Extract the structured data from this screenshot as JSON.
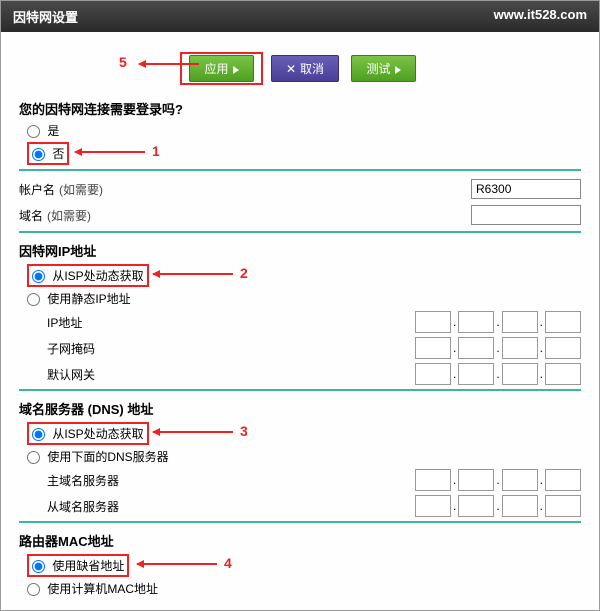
{
  "title_bar": "因特网设置",
  "watermark": "www.it528.com",
  "buttons": {
    "apply": "应用",
    "cancel": "取消",
    "test": "测试"
  },
  "annotations": {
    "n1": "1",
    "n2": "2",
    "n3": "3",
    "n4": "4",
    "n5": "5"
  },
  "q_login": {
    "title": "您的因特网连接需要登录吗?",
    "opt_yes": "是",
    "opt_no": "否"
  },
  "account": {
    "user_label": "帐户名",
    "note": "(如需要)",
    "user_value": "R6300",
    "domain_label": "域名"
  },
  "ip_section": {
    "title": "因特网IP地址",
    "opt_dynamic": "从ISP处动态获取",
    "opt_static": "使用静态IP地址",
    "ip_label": "IP地址",
    "subnet_label": "子网掩码",
    "gateway_label": "默认网关"
  },
  "dns_section": {
    "title": "域名服务器 (DNS) 地址",
    "opt_dynamic": "从ISP处动态获取",
    "opt_manual": "使用下面的DNS服务器",
    "primary_label": "主域名服务器",
    "secondary_label": "从域名服务器"
  },
  "mac_section": {
    "title": "路由器MAC地址",
    "opt_default": "使用缺省地址",
    "opt_pc": "使用计算机MAC地址"
  }
}
